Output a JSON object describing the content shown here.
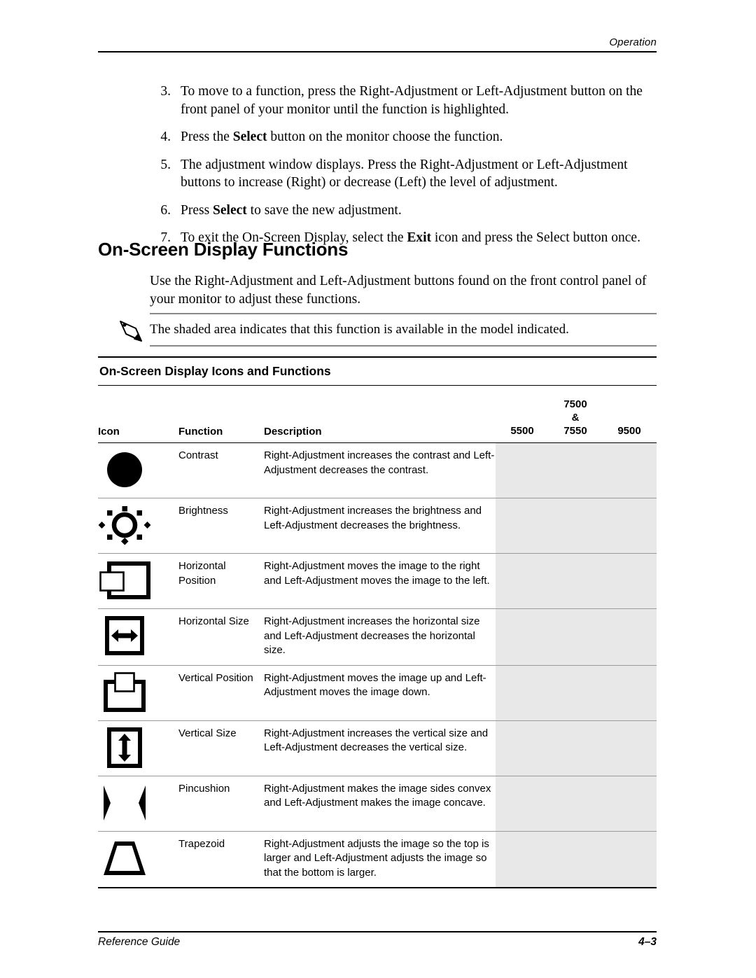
{
  "header": {
    "running_head": "Operation"
  },
  "steps": [
    {
      "num": "3.",
      "text_parts": [
        {
          "t": "To move to a function, press the Right-Adjustment or Left-Adjustment button on the front panel of your monitor until the function is highlighted.",
          "b": false
        }
      ]
    },
    {
      "num": "4.",
      "text_parts": [
        {
          "t": "Press the ",
          "b": false
        },
        {
          "t": "Select",
          "b": true
        },
        {
          "t": " button on the monitor choose the function.",
          "b": false
        }
      ]
    },
    {
      "num": "5.",
      "text_parts": [
        {
          "t": "The adjustment window displays. Press the Right-Adjustment or Left-Adjustment buttons to increase (Right) or decrease (Left) the level of adjustment.",
          "b": false
        }
      ]
    },
    {
      "num": "6.",
      "text_parts": [
        {
          "t": "Press ",
          "b": false
        },
        {
          "t": "Select",
          "b": true
        },
        {
          "t": " to save the new adjustment.",
          "b": false
        }
      ]
    },
    {
      "num": "7.",
      "text_parts": [
        {
          "t": "To exit the On-Screen Display, select the ",
          "b": false
        },
        {
          "t": "Exit",
          "b": true
        },
        {
          "t": " icon and press the Select button once.",
          "b": false
        }
      ]
    }
  ],
  "section": {
    "heading": "On-Screen Display Functions",
    "intro": "Use the Right-Adjustment and Left-Adjustment buttons found on the front control panel of your monitor to adjust these functions.",
    "note": "The shaded area indicates that this function is available in the model indicated."
  },
  "table": {
    "caption": "On-Screen Display Icons and Functions",
    "headers": {
      "icon": "Icon",
      "function": "Function",
      "description": "Description",
      "model_5500": "5500",
      "model_7500_line1": "7500",
      "model_7500_line2": "&",
      "model_7500_line3": "7550",
      "model_9500": "9500"
    },
    "rows": [
      {
        "icon": "contrast-icon",
        "function": "Contrast",
        "description": "Right-Adjustment increases the contrast and Left-Adjustment decreases the contrast.",
        "shaded": {
          "m5500": true,
          "m7500": true,
          "m9500": true
        }
      },
      {
        "icon": "brightness-icon",
        "function": "Brightness",
        "description": "Right-Adjustment increases the brightness and Left-Adjustment decreases the brightness.",
        "shaded": {
          "m5500": true,
          "m7500": true,
          "m9500": true
        }
      },
      {
        "icon": "horizontal-position-icon",
        "function": "Horizontal Position",
        "description": "Right-Adjustment moves the image to the right and Left-Adjustment moves the image to the left.",
        "shaded": {
          "m5500": true,
          "m7500": true,
          "m9500": true
        }
      },
      {
        "icon": "horizontal-size-icon",
        "function": "Horizontal Size",
        "description": "Right-Adjustment increases the horizontal size and Left-Adjustment decreases the horizontal size.",
        "shaded": {
          "m5500": true,
          "m7500": true,
          "m9500": true
        }
      },
      {
        "icon": "vertical-position-icon",
        "function": "Vertical Position",
        "description": "Right-Adjustment moves the image up and Left-Adjustment moves the image down.",
        "shaded": {
          "m5500": true,
          "m7500": true,
          "m9500": true
        }
      },
      {
        "icon": "vertical-size-icon",
        "function": "Vertical Size",
        "description": "Right-Adjustment increases the vertical size and Left-Adjustment decreases the vertical size.",
        "shaded": {
          "m5500": true,
          "m7500": true,
          "m9500": true
        }
      },
      {
        "icon": "pincushion-icon",
        "function": "Pincushion",
        "description": "Right-Adjustment makes the image sides convex and Left-Adjustment makes the image concave.",
        "shaded": {
          "m5500": true,
          "m7500": true,
          "m9500": true
        }
      },
      {
        "icon": "trapezoid-icon",
        "function": "Trapezoid",
        "description": "Right-Adjustment adjusts the image so the top is larger and Left-Adjustment adjusts the image so that the bottom is larger.",
        "shaded": {
          "m5500": true,
          "m7500": true,
          "m9500": true
        }
      }
    ]
  },
  "footer": {
    "guide": "Reference Guide",
    "page": "4–3"
  },
  "colors": {
    "shade": "#e8e8e8",
    "rule": "#000000",
    "rule_light": "#999999"
  }
}
